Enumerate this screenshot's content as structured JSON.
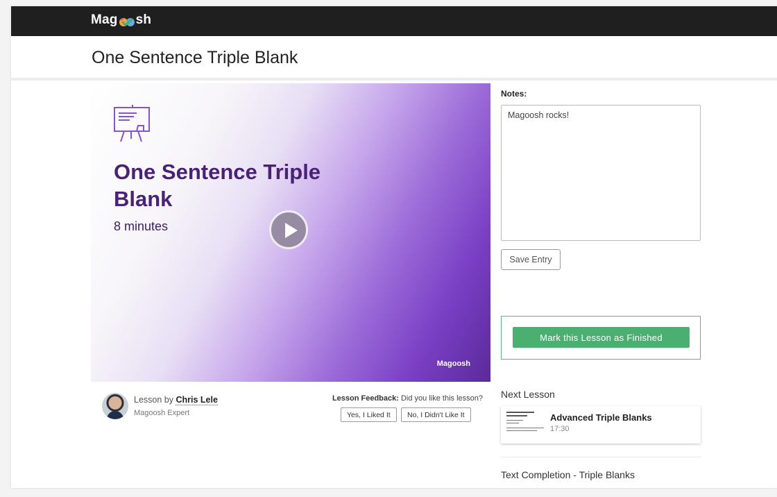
{
  "header": {
    "logo": {
      "prefix": "Mag",
      "suffix": "sh"
    }
  },
  "page": {
    "title": "One Sentence Triple Blank"
  },
  "video": {
    "title": "One Sentence Triple Blank",
    "duration": "8 minutes",
    "icon": "easel-icon",
    "play_icon": "play-icon",
    "watermark": "Magoosh"
  },
  "author": {
    "prefix": "Lesson by",
    "name": "Chris Lele",
    "role": "Magoosh Expert"
  },
  "feedback": {
    "label": "Lesson Feedback:",
    "question": "Did you like this lesson?",
    "yes_label": "Yes, I Liked It",
    "no_label": "No, I Didn't Like It"
  },
  "notes": {
    "label": "Notes:",
    "value": "Magoosh rocks!",
    "save_label": "Save Entry"
  },
  "finish": {
    "label": "Mark this Lesson as Finished"
  },
  "next": {
    "label": "Next Lesson",
    "title": "Advanced Triple Blanks",
    "time": "17:30"
  },
  "section": {
    "title": "Text Completion - Triple Blanks"
  },
  "colors": {
    "header_bg": "#1f1f1f",
    "accent_purple": "#4a2275",
    "finish_green": "#4caf72"
  }
}
